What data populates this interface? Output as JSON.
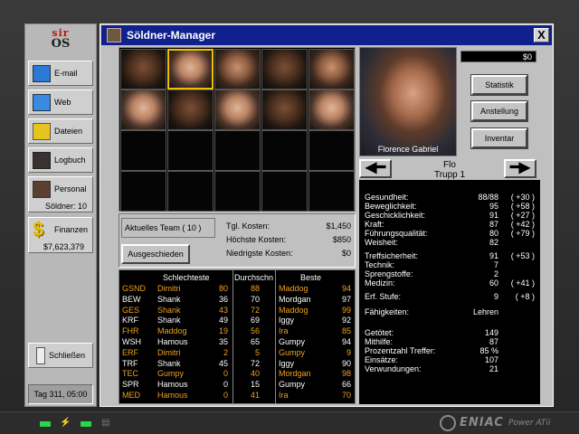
{
  "os": {
    "brand_top": "sir",
    "brand_bottom": "OS"
  },
  "sidebar": {
    "items": [
      {
        "label": "E-mail",
        "icon": "email-icon"
      },
      {
        "label": "Web",
        "icon": "web-icon"
      },
      {
        "label": "Dateien",
        "icon": "folder-icon"
      },
      {
        "label": "Logbuch",
        "icon": "book-icon"
      }
    ],
    "personal": {
      "label": "Personal",
      "sub": "Söldner: 10"
    },
    "finanzen": {
      "label": "Finanzen",
      "sub": "$7,623,379"
    },
    "logout": "Schließen",
    "date": "Tag 311, 05:00"
  },
  "window": {
    "title": "Söldner-Manager",
    "close": "X",
    "money": "$0",
    "portrait_name": "Florence Gabriel",
    "buttons": {
      "statistik": "Statistik",
      "anstellung": "Anstellung",
      "inventar": "Inventar"
    },
    "arrow_left": "◀━",
    "arrow_right": "━▶",
    "nickname": "Flo",
    "squad": "Trupp 1"
  },
  "stats": [
    {
      "k": "Gesundheit:",
      "v": "88/88",
      "b": "( +30 )"
    },
    {
      "k": "Beweglichkeit:",
      "v": "95",
      "b": "( +58 )"
    },
    {
      "k": "Geschicklichkeit:",
      "v": "91",
      "b": "( +27 )"
    },
    {
      "k": "Kraft:",
      "v": "87",
      "b": "( +42 )"
    },
    {
      "k": "Führungsqualität:",
      "v": "80",
      "b": "( +79 )"
    },
    {
      "k": "Weisheit:",
      "v": "82",
      "b": ""
    },
    {
      "k": "Treffsicherheit:",
      "v": "91",
      "b": "( +53 )"
    },
    {
      "k": "Technik:",
      "v": "7",
      "b": ""
    },
    {
      "k": "Sprengstoffe:",
      "v": "2",
      "b": ""
    },
    {
      "k": "Medizin:",
      "v": "60",
      "b": "( +41 )"
    },
    {
      "k": "Erf. Stufe:",
      "v": "9",
      "b": "( +8 )"
    },
    {
      "k": "Fähigkeiten:",
      "v": "Lehren",
      "b": ""
    },
    {
      "k": "Getötet:",
      "v": "149",
      "b": ""
    },
    {
      "k": "Mithilfe:",
      "v": "87",
      "b": ""
    },
    {
      "k": "Prozentzahl Treffer:",
      "v": "85 %",
      "b": ""
    },
    {
      "k": "Einsätze:",
      "v": "107",
      "b": ""
    },
    {
      "k": "Verwundungen:",
      "v": "21",
      "b": ""
    }
  ],
  "costs": {
    "team": "Aktuelles Team ( 10 )",
    "ausgeschieden": "Ausgeschieden",
    "rows": [
      {
        "k": "Tgl. Kosten:",
        "v": "$1,450"
      },
      {
        "k": "Höchste Kosten:",
        "v": "$850"
      },
      {
        "k": "Niedrigste Kosten:",
        "v": "$0"
      }
    ]
  },
  "table": {
    "headers": {
      "worst": "Schlechteste",
      "avg": "Durchschn",
      "best": "Beste"
    },
    "rows": [
      {
        "attr": "GSND",
        "w": "Dimitri",
        "wv": "80",
        "a": "88",
        "b": "Maddog",
        "bv": "94",
        "hl": true
      },
      {
        "attr": "BEW",
        "w": "Shank",
        "wv": "36",
        "a": "70",
        "b": "Mordgan",
        "bv": "97",
        "hl": false
      },
      {
        "attr": "GES",
        "w": "Shank",
        "wv": "43",
        "a": "72",
        "b": "Maddog",
        "bv": "99",
        "hl": true
      },
      {
        "attr": "KRF",
        "w": "Shank",
        "wv": "49",
        "a": "69",
        "b": "Iggy",
        "bv": "92",
        "hl": false
      },
      {
        "attr": "FHR",
        "w": "Maddog",
        "wv": "19",
        "a": "56",
        "b": "Ira",
        "bv": "85",
        "hl": true
      },
      {
        "attr": "WSH",
        "w": "Hamous",
        "wv": "35",
        "a": "65",
        "b": "Gumpy",
        "bv": "94",
        "hl": false
      },
      {
        "attr": "ERF",
        "w": "Dimitri",
        "wv": "2",
        "a": "5",
        "b": "Gumpy",
        "bv": "9",
        "hl": true
      },
      {
        "attr": "TRF",
        "w": "Shank",
        "wv": "45",
        "a": "72",
        "b": "Iggy",
        "bv": "90",
        "hl": false
      },
      {
        "attr": "TEC",
        "w": "Gumpy",
        "wv": "0",
        "a": "40",
        "b": "Mordgan",
        "bv": "98",
        "hl": true
      },
      {
        "attr": "SPR",
        "w": "Hamous",
        "wv": "0",
        "a": "15",
        "b": "Gumpy",
        "bv": "66",
        "hl": false
      },
      {
        "attr": "MED",
        "w": "Hamous",
        "wv": "0",
        "a": "41",
        "b": "Ira",
        "bv": "70",
        "hl": true
      }
    ]
  },
  "taskbar": {
    "brand": "ENIAC",
    "sub": "Power ATii"
  }
}
